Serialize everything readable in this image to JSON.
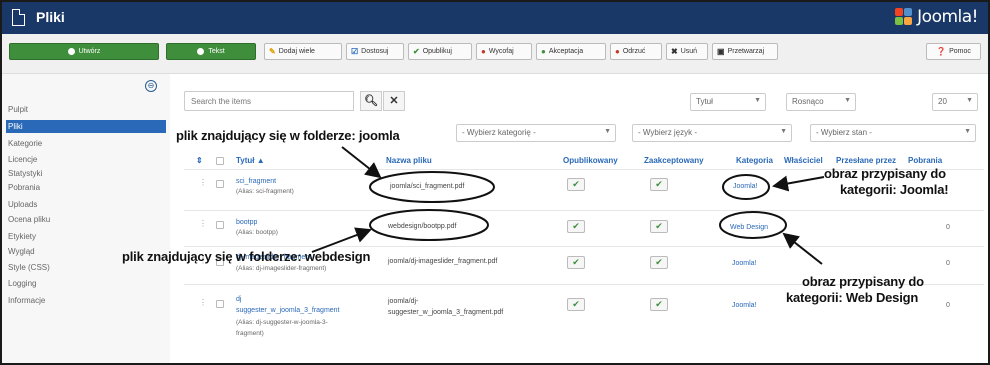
{
  "header": {
    "title": "Pliki",
    "logo_text": "Joomla!"
  },
  "toolbar": {
    "new_label": "Utwórz",
    "new2_label": "Tekst",
    "add_label": "Dodaj wiele",
    "edit_label": "Dostosuj",
    "publish_label": "Opublikuj",
    "unpublish_label": "Wycofaj",
    "accept_label": "Akceptacja",
    "reject_label": "Odrzuć",
    "delete_label": "Usuń",
    "process_label": "Przetwarzaj",
    "help_label": "Pomoc"
  },
  "sidebar": {
    "items": [
      {
        "label": "Pulpit"
      },
      {
        "label": "Pliki"
      },
      {
        "label": "Kategorie"
      },
      {
        "label": "Licencje"
      },
      {
        "label": "Statystyki"
      },
      {
        "label": "Pobrania"
      },
      {
        "label": "Uploads"
      },
      {
        "label": "Ocena pliku"
      },
      {
        "label": "Etykiety"
      },
      {
        "label": "Wygląd"
      },
      {
        "label": "Style (CSS)"
      },
      {
        "label": "Logging"
      },
      {
        "label": "Informacje"
      }
    ]
  },
  "filters": {
    "search_placeholder": "Search the items",
    "sort_field": "Tytuł",
    "sort_dir": "Rosnąco",
    "limit": "20",
    "category": "- Wybierz kategorię -",
    "language": "- Wybierz język -",
    "state": "- Wybierz stan -"
  },
  "table": {
    "columns": {
      "title": "Tytuł ▲",
      "filename": "Nazwa pliku",
      "published": "Opublikowany",
      "accepted": "Zaakceptowany",
      "category": "Kategoria",
      "owner": "Właściciel",
      "assigned": "Przesłane przez",
      "downloads": "Pobrania"
    },
    "rows": [
      {
        "title": "sci_fragment",
        "alias": "(Alias: sci-fragment)",
        "file": "joomla/sci_fragment.pdf",
        "category": "Joomla!",
        "downloads": ""
      },
      {
        "title": "bootpp",
        "alias": "(Alias: bootpp)",
        "file": "webdesign/bootpp.pdf",
        "category": "Web Design",
        "downloads": "0"
      },
      {
        "title": "dj-imageslider_fragment",
        "alias": "(Alias: dj-imageslider-fragment)",
        "file": "joomla/dj-imageslider_fragment.pdf",
        "category": "Joomla!",
        "downloads": "0"
      },
      {
        "title": "dj",
        "title2": "suggester_w_joomla_3_fragment",
        "alias": "(Alias: dj-suggester-w-joomla-3-",
        "alias2": "fragment)",
        "file": "joomla/dj-",
        "file2": "suggester_w_joomla_3_fragment.pdf",
        "category": "Joomla!",
        "downloads": "0"
      }
    ]
  },
  "annotations": {
    "a1": "plik znajdujący się w folderze: joomla",
    "a2": "plik znajdujący się w folderze: webdesign",
    "a3_line1": "obraz przypisany do",
    "a3_line2": "kategorii: Joomla!",
    "a4_line1": "obraz przypisany do",
    "a4_line2": "kategorii: Web Design"
  },
  "colors": {
    "header_bg": "#1a3867",
    "active_nav": "#2a69b8",
    "green_button": "#3f8e3c",
    "link": "#2a69b8"
  }
}
